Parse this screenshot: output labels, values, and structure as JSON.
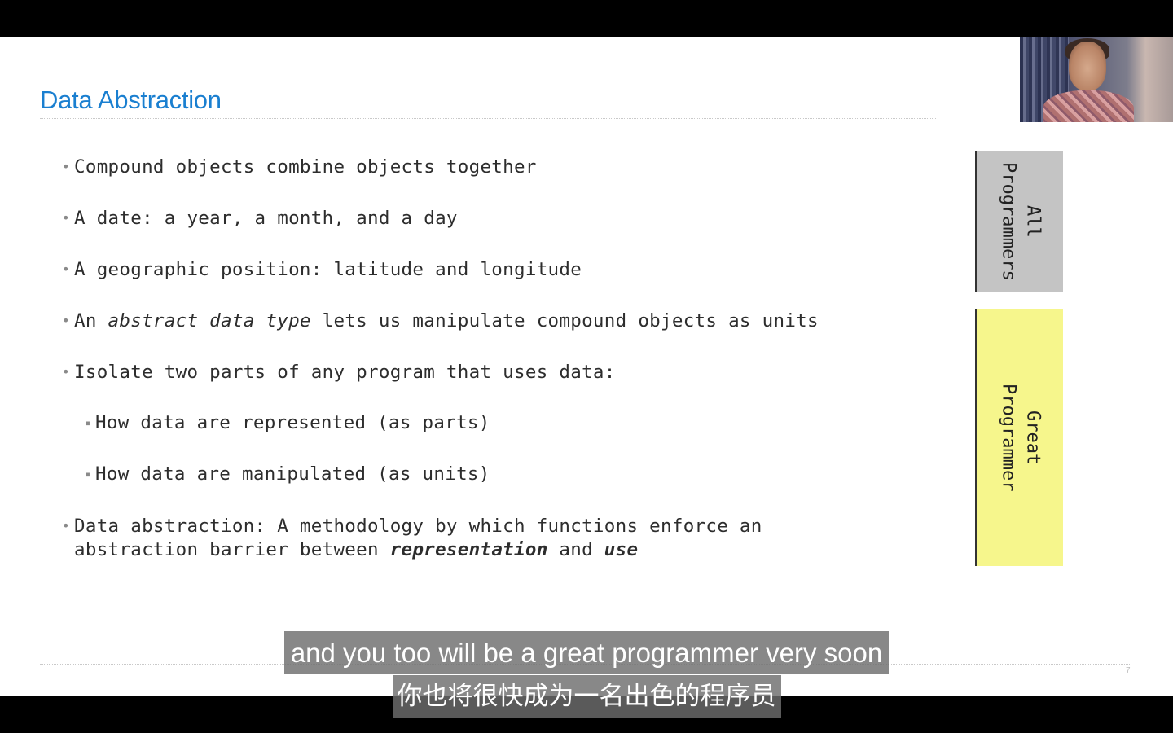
{
  "slide": {
    "title": "Data Abstraction",
    "page_number": "7",
    "bullets": {
      "b1": "Compound objects combine objects together",
      "b2": "A date: a year, a month, and a day",
      "b3": "A geographic position: latitude and longitude",
      "b4_pre": "An ",
      "b4_em": "abstract data type",
      "b4_post": " lets us manipulate compound objects as units",
      "b5": "Isolate two parts of any program that uses data:",
      "b6": "How data are represented (as parts)",
      "b7": "How data are manipulated (as units)",
      "b8_line1": "Data abstraction: A methodology by which functions enforce an",
      "b8_line2_pre": "abstraction barrier between ",
      "b8_em1": "representation",
      "b8_mid": " and ",
      "b8_em2": "use"
    },
    "side_boxes": {
      "all_label": "All\nProgrammers",
      "great_label": "Great\nProgrammer",
      "all_color": "#c4c4c4",
      "great_color": "#f6f68c"
    }
  },
  "subtitles": {
    "english": "and you too will be a great programmer very soon",
    "chinese": "你也将很快成为一名出色的程序员"
  },
  "colors": {
    "title": "#1a7fd0",
    "body_text": "#2d2d2d"
  }
}
